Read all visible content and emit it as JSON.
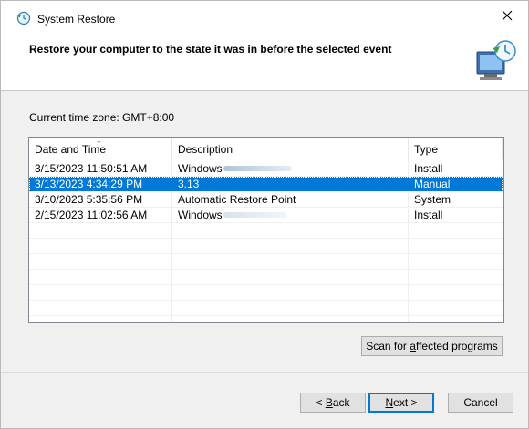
{
  "window": {
    "title": "System Restore"
  },
  "header": {
    "title": "Restore your computer to the state it was in before the selected event"
  },
  "timezone_label": "Current time zone: GMT+8:00",
  "table": {
    "columns": [
      "Date and Time",
      "Description",
      "Type"
    ],
    "rows": [
      {
        "date": "3/15/2023 11:50:51 AM",
        "description": "Windows",
        "type": "Install",
        "selected": false
      },
      {
        "date": "3/13/2023 4:34:29 PM",
        "description": "3.13",
        "type": "Manual",
        "selected": true
      },
      {
        "date": "3/10/2023 5:35:56 PM",
        "description": "Automatic Restore Point",
        "type": "System",
        "selected": false
      },
      {
        "date": "2/15/2023 11:02:56 AM",
        "description": "Windows",
        "type": "Install",
        "selected": false
      }
    ]
  },
  "buttons": {
    "scan_pre": "Scan for ",
    "scan_u": "a",
    "scan_post": "ffected programs",
    "back_pre": "< ",
    "back_u": "B",
    "back_post": "ack",
    "next_u": "N",
    "next_post": "ext >",
    "cancel": "Cancel"
  },
  "colors": {
    "accent": "#0078d7",
    "selected_row": "#0078d7"
  }
}
